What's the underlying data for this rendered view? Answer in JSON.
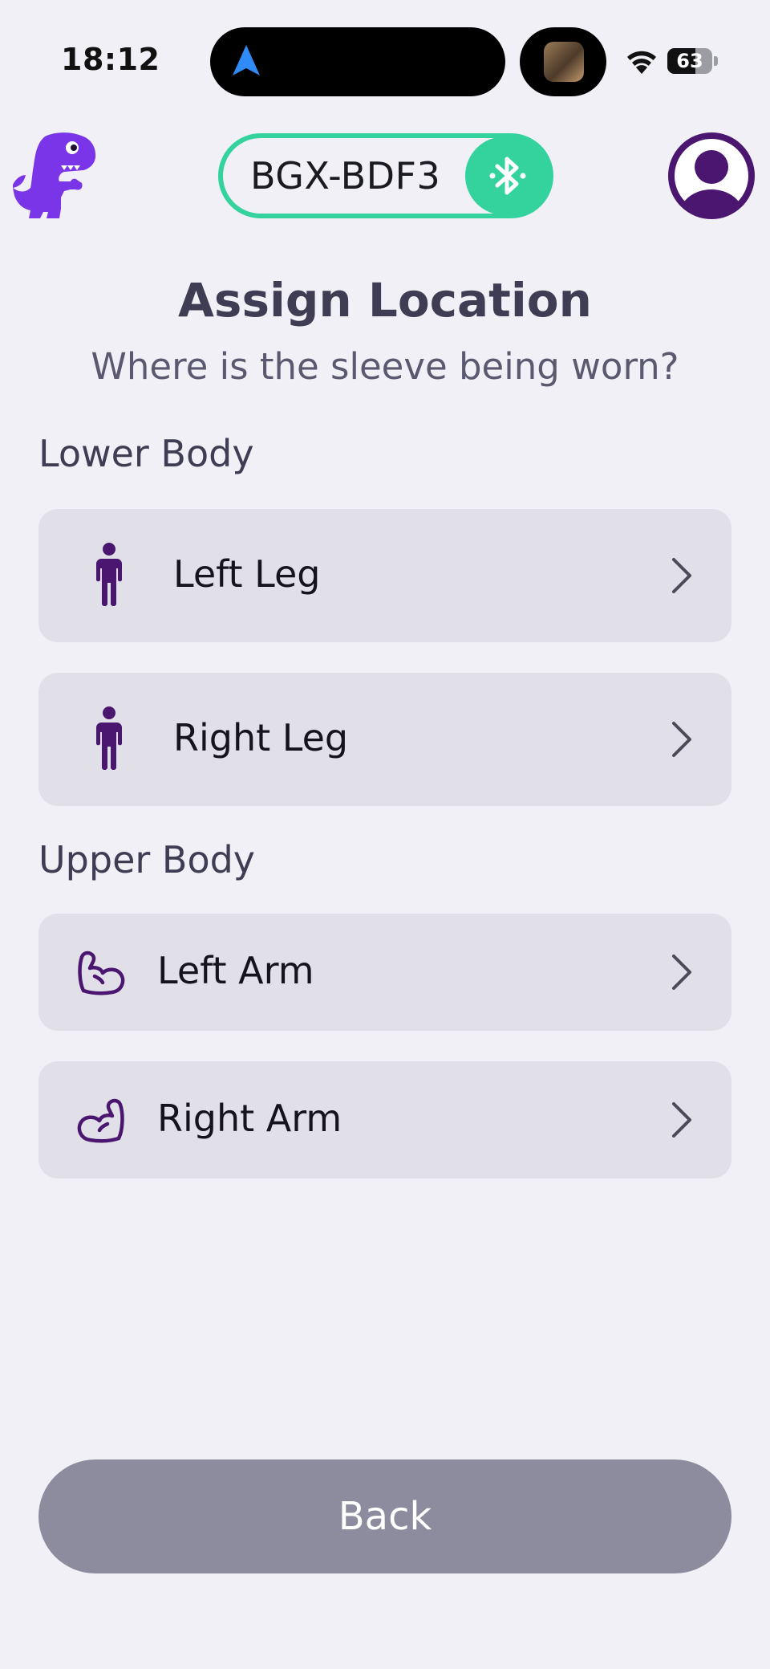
{
  "status_bar": {
    "time": "18:12",
    "battery_percent": 63,
    "battery_label": "63"
  },
  "header": {
    "device_name": "BGX-BDF3"
  },
  "page": {
    "title": "Assign Location",
    "subtitle": "Where is the sleeve being worn?"
  },
  "sections": {
    "lower_body": {
      "title": "Lower Body",
      "items": [
        {
          "label": "Left Leg",
          "icon": "person-icon"
        },
        {
          "label": "Right Leg",
          "icon": "person-icon"
        }
      ]
    },
    "upper_body": {
      "title": "Upper Body",
      "items": [
        {
          "label": "Left Arm",
          "icon": "flexed-arm-icon"
        },
        {
          "label": "Right Arm",
          "icon": "flexed-arm-icon"
        }
      ]
    }
  },
  "footer": {
    "back_label": "Back"
  },
  "colors": {
    "accent_green": "#34D39E",
    "brand_purple": "#7B35E8",
    "icon_purple": "#4A1670",
    "background": "#F1F0F6",
    "card": "#E1E0E8",
    "back_button": "#8C8C9E"
  }
}
